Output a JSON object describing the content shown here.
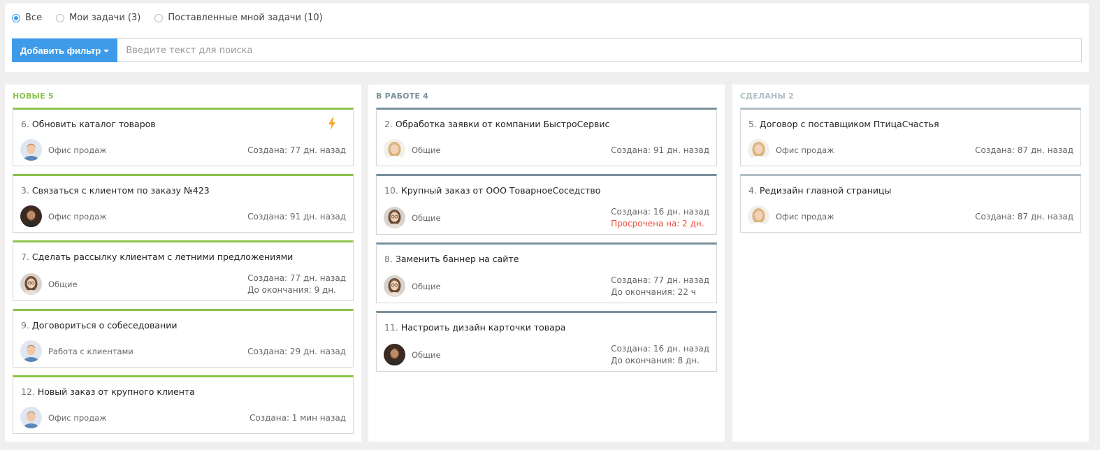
{
  "filters": {
    "radios": [
      {
        "label": "Все",
        "checked": true
      },
      {
        "label": "Мои задачи (3)",
        "checked": false
      },
      {
        "label": "Поставленные мной задачи (10)",
        "checked": false
      }
    ],
    "add_filter_label": "Добавить фильтр",
    "search_placeholder": "Введите текст для поиска"
  },
  "columns": [
    {
      "title": "НОВЫЕ 5",
      "color": "#8bc34a",
      "cards": [
        {
          "num": "6.",
          "title": "Обновить каталог товаров",
          "project": "Офис продаж",
          "line1": "Создана: 77 дн. назад",
          "line2": "",
          "urgent": true,
          "avatar": "man-light"
        },
        {
          "num": "3.",
          "title": "Связаться с клиентом по заказу №423",
          "project": "Офис продаж",
          "line1": "Создана: 91 дн. назад",
          "line2": "",
          "avatar": "man-beard"
        },
        {
          "num": "7.",
          "title": "Сделать рассылку клиентам с летними предложениями",
          "project": "Общие",
          "line1": "Создана: 77 дн. назад",
          "line2": "До окончания: 9 дн.",
          "avatar": "woman-glasses"
        },
        {
          "num": "9.",
          "title": "Договориться о собеседовании",
          "project": "Работа с клиентами",
          "line1": "Создана: 29 дн. назад",
          "line2": "",
          "avatar": "man-light"
        },
        {
          "num": "12.",
          "title": "Новый заказ от крупного клиента",
          "project": "Офис продаж",
          "line1": "Создана: 1 мин назад",
          "line2": "",
          "avatar": "man-light"
        }
      ]
    },
    {
      "title": "В РАБОТЕ 4",
      "color": "#78909c",
      "cards": [
        {
          "num": "2.",
          "title": "Обработка заявки от компании БыстроСервис",
          "project": "Общие",
          "line1": "Создана: 91 дн. назад",
          "line2": "",
          "avatar": "woman-blonde"
        },
        {
          "num": "10.",
          "title": "Крупный заказ от ООО ТоварноеСоседство",
          "project": "Общие",
          "line1": "Создана: 16 дн. назад",
          "line2": "Просрочена на: 2 дн.",
          "overdue": true,
          "avatar": "woman-glasses"
        },
        {
          "num": "8.",
          "title": "Заменить баннер на сайте",
          "project": "Общие",
          "line1": "Создана: 77 дн. назад",
          "line2": "До окончания: 22 ч",
          "avatar": "woman-glasses"
        },
        {
          "num": "11.",
          "title": "Настроить дизайн карточки товара",
          "project": "Общие",
          "line1": "Создана: 16 дн. назад",
          "line2": "До окончания: 8 дн.",
          "avatar": "man-beard"
        }
      ]
    },
    {
      "title": "СДЕЛАНЫ 2",
      "color": "#b0bec5",
      "cards": [
        {
          "num": "5.",
          "title": "Договор с поставщиком ПтицаСчастья",
          "project": "Офис продаж",
          "line1": "Создана: 87 дн. назад",
          "line2": "",
          "avatar": "woman-blonde"
        },
        {
          "num": "4.",
          "title": "Редизайн главной страницы",
          "project": "Офис продаж",
          "line1": "Создана: 87 дн. назад",
          "line2": "",
          "avatar": "woman-blonde"
        }
      ]
    }
  ]
}
